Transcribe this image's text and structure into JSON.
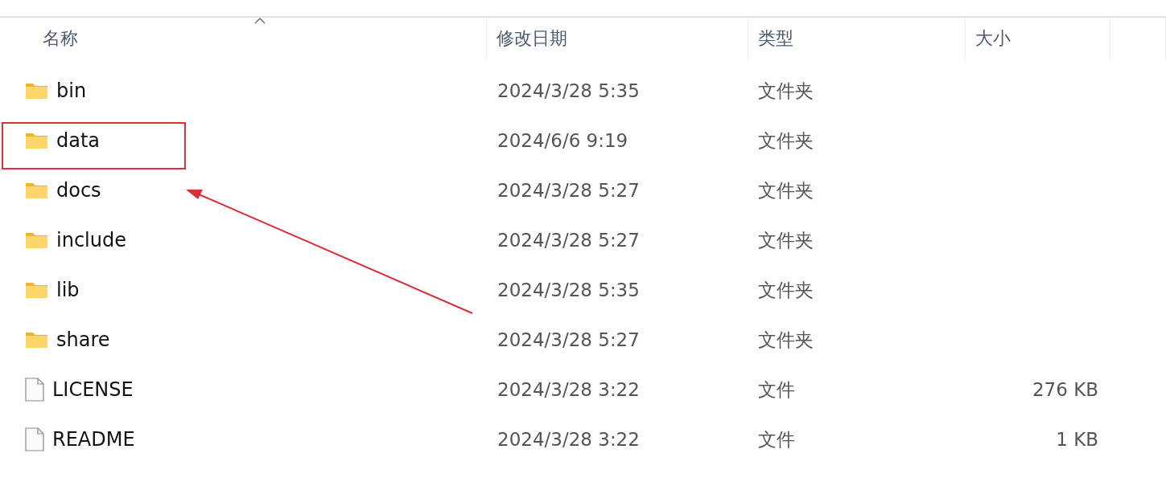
{
  "columns": [
    {
      "label": "名称",
      "sorted": true
    },
    {
      "label": "修改日期",
      "sorted": false
    },
    {
      "label": "类型",
      "sorted": false
    },
    {
      "label": "大小",
      "sorted": false
    }
  ],
  "rows": [
    {
      "kind": "folder",
      "name": "bin",
      "modified": "2024/3/28 5:35",
      "type": "文件夹",
      "highlighted": false
    },
    {
      "kind": "folder",
      "name": "data",
      "modified": "2024/6/6 9:19",
      "type": "文件夹",
      "highlighted": true
    },
    {
      "kind": "folder",
      "name": "docs",
      "modified": "2024/3/28 5:27",
      "type": "文件夹",
      "highlighted": false
    },
    {
      "kind": "folder",
      "name": "include",
      "modified": "2024/3/28 5:27",
      "type": "文件夹",
      "highlighted": false
    },
    {
      "kind": "folder",
      "name": "lib",
      "modified": "2024/3/28 5:35",
      "type": "文件夹",
      "highlighted": false
    },
    {
      "kind": "folder",
      "name": "share",
      "modified": "2024/3/28 5:27",
      "type": "文件夹",
      "highlighted": false
    },
    {
      "kind": "file",
      "name": "LICENSE",
      "modified": "2024/3/28 3:22",
      "type": "文件",
      "size": "276 KB",
      "highlighted": false
    },
    {
      "kind": "file",
      "name": "README",
      "modified": "2024/3/28 3:22",
      "type": "文件",
      "size": "1 KB",
      "highlighted": false
    }
  ]
}
